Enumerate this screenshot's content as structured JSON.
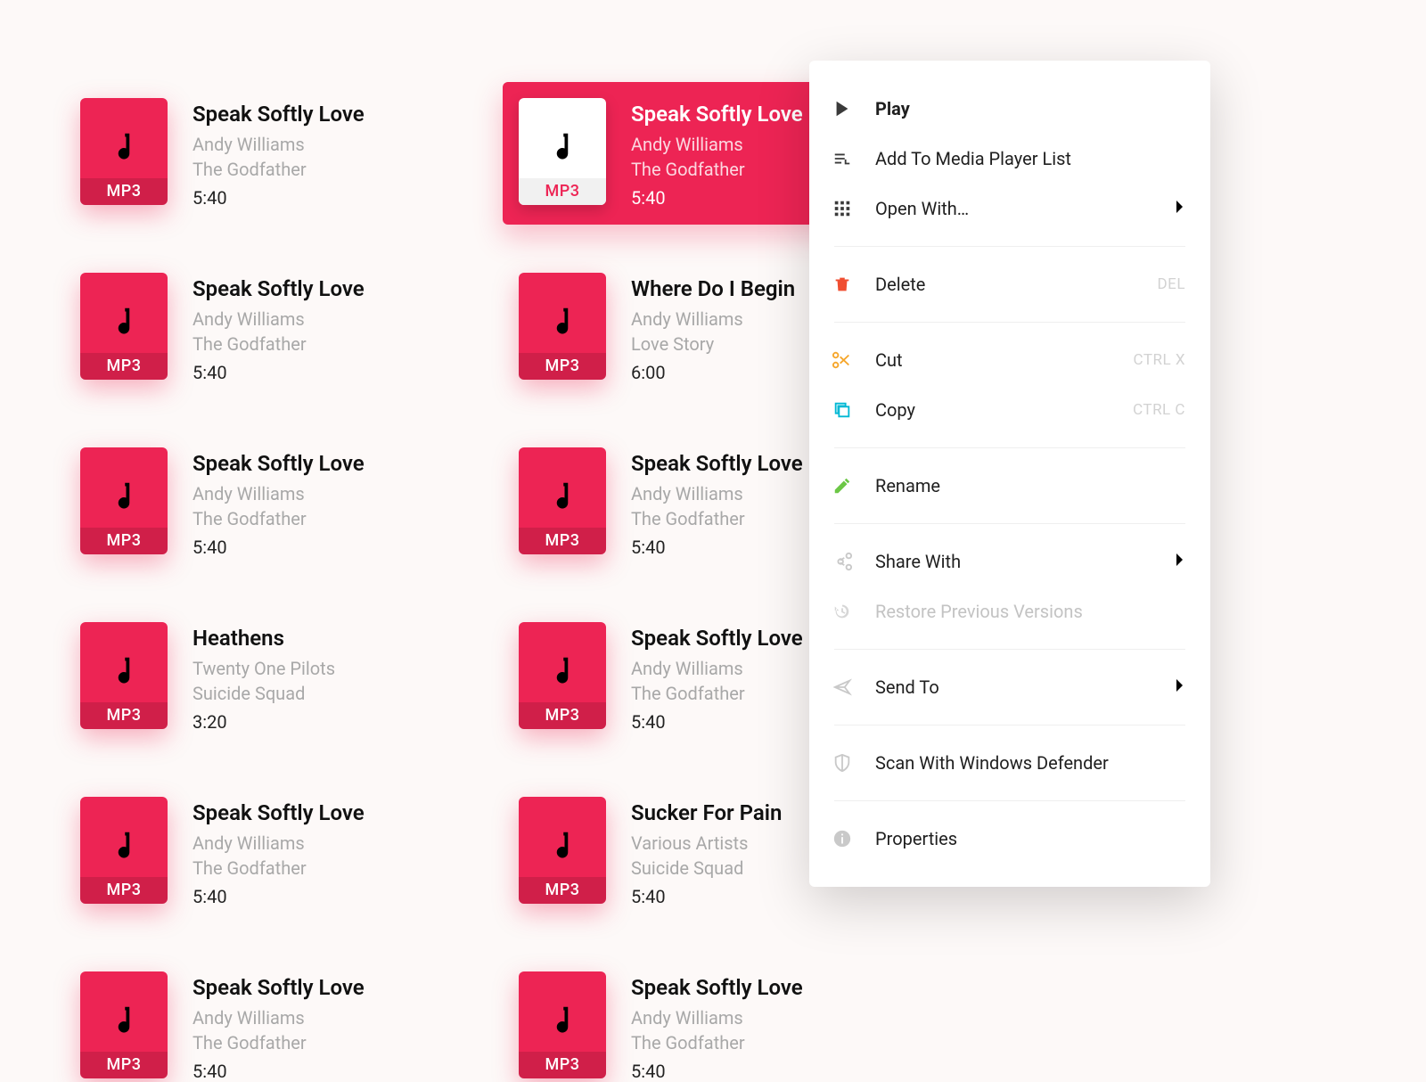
{
  "file_badge": "MP3",
  "tracks": [
    {
      "title": "Speak Softly Love",
      "artist": "Andy Williams",
      "album": "The Godfather",
      "duration": "5:40",
      "selected": false
    },
    {
      "title": "Speak Softly Love",
      "artist": "Andy Williams",
      "album": "The Godfather",
      "duration": "5:40",
      "selected": true
    },
    {
      "title": "Speak Softly Love",
      "artist": "Andy Williams",
      "album": "The Godfather",
      "duration": "5:40",
      "selected": false
    },
    {
      "title": "Where Do I Begin",
      "artist": "Andy Williams",
      "album": "Love Story",
      "duration": "6:00",
      "selected": false
    },
    {
      "title": "Speak Softly Love",
      "artist": "Andy Williams",
      "album": "The Godfather",
      "duration": "5:40",
      "selected": false
    },
    {
      "title": "Speak Softly Love",
      "artist": "Andy Williams",
      "album": "The Godfather",
      "duration": "5:40",
      "selected": false
    },
    {
      "title": "Heathens",
      "artist": "Twenty One Pilots",
      "album": "Suicide Squad",
      "duration": "3:20",
      "selected": false
    },
    {
      "title": "Speak Softly Love",
      "artist": "Andy Williams",
      "album": "The Godfather",
      "duration": "5:40",
      "selected": false
    },
    {
      "title": "Speak Softly Love",
      "artist": "Andy Williams",
      "album": "The Godfather",
      "duration": "5:40",
      "selected": false
    },
    {
      "title": "Sucker For Pain",
      "artist": "Various Artists",
      "album": "Suicide Squad",
      "duration": "5:40",
      "selected": false
    },
    {
      "title": "Speak Softly Love",
      "artist": "Andy Williams",
      "album": "The Godfather",
      "duration": "5:40",
      "selected": false
    },
    {
      "title": "Speak Softly Love",
      "artist": "Andy Williams",
      "album": "The Godfather",
      "duration": "5:40",
      "selected": false
    }
  ],
  "context_menu": {
    "items": [
      {
        "id": "play",
        "label": "Play",
        "icon": "play-icon",
        "bold": true
      },
      {
        "id": "addlist",
        "label": "Add To Media Player List",
        "icon": "playlist-add-icon"
      },
      {
        "id": "openwith",
        "label": "Open With…",
        "icon": "apps-grid-icon",
        "submenu": true
      },
      {
        "sep": true
      },
      {
        "id": "delete",
        "label": "Delete",
        "icon": "trash-icon",
        "shortcut": "DEL",
        "icon_color": "#f04e31"
      },
      {
        "sep": true
      },
      {
        "id": "cut",
        "label": "Cut",
        "icon": "scissors-icon",
        "shortcut": "CTRL X",
        "icon_color": "#f6a62a"
      },
      {
        "id": "copy",
        "label": "Copy",
        "icon": "copy-icon",
        "shortcut": "CTRL C",
        "icon_color": "#00b8d4"
      },
      {
        "sep": true
      },
      {
        "id": "rename",
        "label": "Rename",
        "icon": "pencil-icon",
        "icon_color": "#6cc746"
      },
      {
        "sep": true
      },
      {
        "id": "share",
        "label": "Share With",
        "icon": "share-icon",
        "submenu": true,
        "icon_color": "#c9c9c9"
      },
      {
        "id": "restore",
        "label": "Restore Previous Versions",
        "icon": "history-icon",
        "disabled": true,
        "icon_color": "#d6d6d6"
      },
      {
        "sep": true
      },
      {
        "id": "sendto",
        "label": "Send To",
        "icon": "send-icon",
        "submenu": true,
        "icon_color": "#c9c9c9"
      },
      {
        "sep": true
      },
      {
        "id": "scan",
        "label": "Scan With Windows Defender",
        "icon": "shield-icon",
        "icon_color": "#c9c9c9"
      },
      {
        "sep": true
      },
      {
        "id": "props",
        "label": "Properties",
        "icon": "info-icon",
        "icon_color": "#c9c9c9"
      }
    ]
  }
}
